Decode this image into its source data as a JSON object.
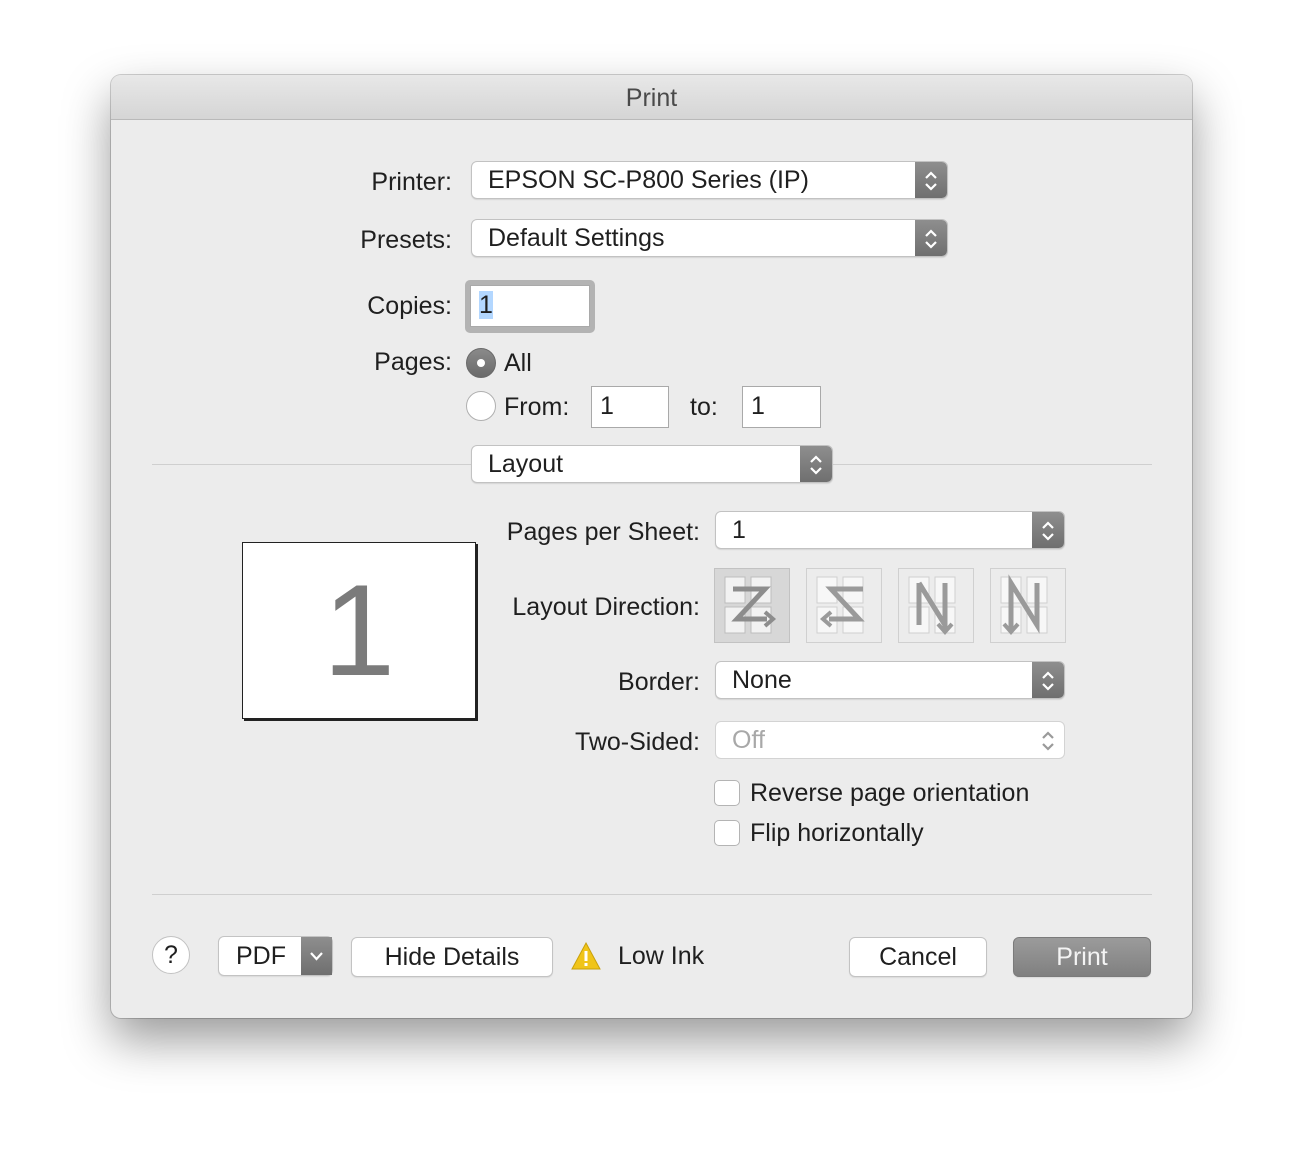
{
  "window": {
    "title": "Print"
  },
  "printer": {
    "label": "Printer:",
    "value": "EPSON SC-P800 Series (IP)"
  },
  "presets": {
    "label": "Presets:",
    "value": "Default Settings"
  },
  "copies": {
    "label": "Copies:",
    "value": "1"
  },
  "pages": {
    "label": "Pages:",
    "all_label": "All",
    "from_label": "From:",
    "from_value": "1",
    "to_label": "to:",
    "to_value": "1",
    "selected": "All"
  },
  "section": {
    "value": "Layout"
  },
  "layout": {
    "preview_number": "1",
    "pages_per_sheet": {
      "label": "Pages per Sheet:",
      "value": "1"
    },
    "layout_direction": {
      "label": "Layout Direction:",
      "options": [
        "z-direction-icon",
        "reverse-z-direction-icon",
        "reverse-n-direction-icon",
        "n-direction-icon"
      ],
      "selected_index": 0
    },
    "border": {
      "label": "Border:",
      "value": "None"
    },
    "two_sided": {
      "label": "Two-Sided:",
      "value": "Off"
    },
    "reverse_orientation": {
      "label": "Reverse page orientation",
      "checked": false
    },
    "flip_horizontally": {
      "label": "Flip horizontally",
      "checked": false
    }
  },
  "footer": {
    "help_label": "?",
    "pdf_label": "PDF",
    "hide_details_label": "Hide Details",
    "warning_label": "Low Ink",
    "cancel_label": "Cancel",
    "print_label": "Print"
  },
  "colors": {
    "default_button": "#8c8c8c",
    "warning": "#f0c419"
  }
}
